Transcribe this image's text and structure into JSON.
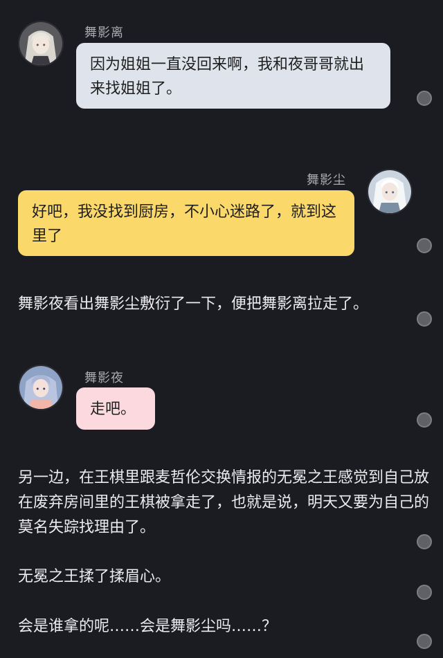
{
  "messages": {
    "m1": {
      "speaker": "舞影离",
      "text": "因为姐姐一直没回来啊，我和夜哥哥就出来找姐姐了。",
      "avatar_icon": "character-avatar-silver-hair"
    },
    "m2": {
      "speaker": "舞影尘",
      "text": "好吧，我没找到厨房，不小心迷路了，就到这里了",
      "avatar_icon": "character-avatar-white-hair"
    },
    "n1": {
      "text": "舞影夜看出舞影尘敷衍了一下，便把舞影离拉走了。"
    },
    "m3": {
      "speaker": "舞影夜",
      "text": "走吧。",
      "avatar_icon": "character-avatar-blue-hair"
    },
    "n2": {
      "text": "另一边，在王棋里跟麦哲伦交换情报的无冕之王感觉到自己放在废弃房间里的王棋被拿走了，也就是说，明天又要为自己的莫名失踪找理由了。"
    },
    "n3": {
      "text": "无冕之王揉了揉眉心。"
    },
    "n4": {
      "text": "会是谁拿的呢……会是舞影尘吗……？"
    }
  },
  "colors": {
    "background": "#1b1c22",
    "bubble_blue": "#dfe4ec",
    "bubble_yellow": "#fbd86a",
    "bubble_pink": "#fbd9df",
    "name_text": "#a9aab0",
    "dot": "#606166"
  }
}
